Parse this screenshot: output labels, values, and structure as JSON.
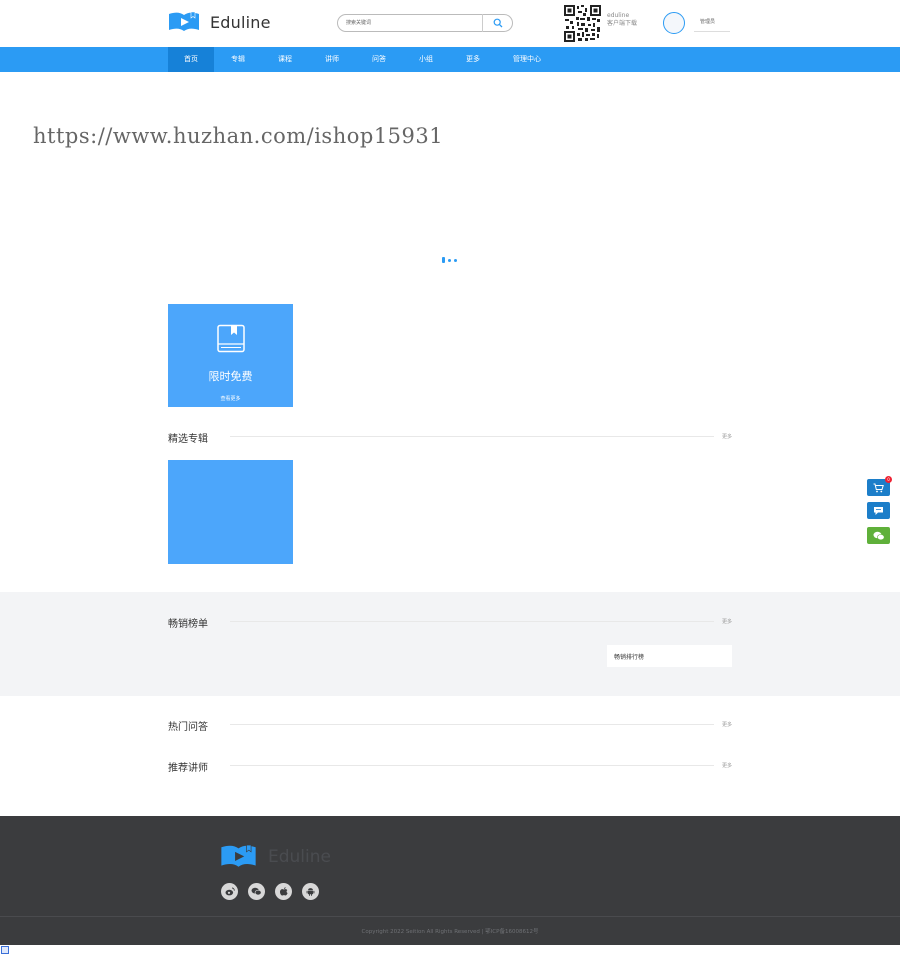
{
  "header": {
    "logo_text": "Eduline",
    "search_placeholder": "搜索关键词",
    "app_name": "eduline",
    "app_download": "客户端下载",
    "user_name": "管理员"
  },
  "nav": {
    "items": [
      "首页",
      "专辑",
      "课程",
      "讲师",
      "问答",
      "小组",
      "更多",
      "管理中心"
    ]
  },
  "watermark": "https://www.huzhan.com/ishop15931",
  "free_card": {
    "title": "限时免费",
    "subtitle": "查看更多"
  },
  "sections": {
    "albums": {
      "title": "精选专辑",
      "more": "更多"
    },
    "bestseller": {
      "title": "畅销榜单",
      "more": "更多",
      "rank_label": "畅销排行榜"
    },
    "qa": {
      "title": "热门问答",
      "more": "更多"
    },
    "teachers": {
      "title": "推荐讲师",
      "more": "更多"
    }
  },
  "float": {
    "cart_count": "0"
  },
  "footer": {
    "logo_text": "Eduline",
    "copyright": "Copyright 2022 Seition All Rights Reserved | 鄂ICP备16008612号"
  },
  "colors": {
    "primary": "#2b9bf4",
    "card": "#4ca6fb",
    "footer": "#3b3c3e",
    "wechat": "#5fb03a"
  }
}
